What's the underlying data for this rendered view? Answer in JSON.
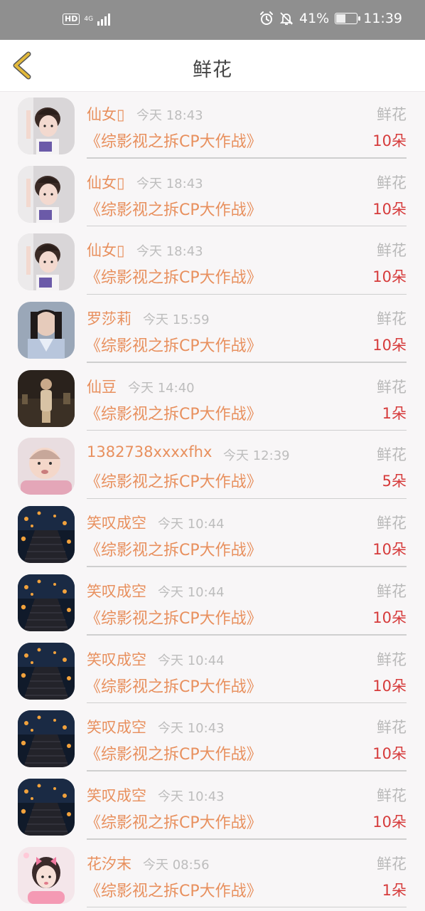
{
  "status_bar": {
    "network_badge": "HD",
    "network_type": "4G",
    "battery_level": 0.41,
    "battery_text": "41%",
    "time": "11:39"
  },
  "header": {
    "title": "鲜花",
    "back_icon": "chevron-left-icon"
  },
  "colors": {
    "accent": "#e8905e",
    "quantity": "#d63b3b",
    "back_arrow": "#e2b93b"
  },
  "records": [
    {
      "name": "仙女▯",
      "time": "今天 18:43",
      "gift": "鲜花",
      "book": "《综影视之拆CP大作战》",
      "quantity": "10朵",
      "avatar": "girl-avatar"
    },
    {
      "name": "仙女▯",
      "time": "今天 18:43",
      "gift": "鲜花",
      "book": "《综影视之拆CP大作战》",
      "quantity": "10朵",
      "avatar": "girl-avatar"
    },
    {
      "name": "仙女▯",
      "time": "今天 18:43",
      "gift": "鲜花",
      "book": "《综影视之拆CP大作战》",
      "quantity": "10朵",
      "avatar": "girl-avatar"
    },
    {
      "name": "罗莎莉",
      "time": "今天 15:59",
      "gift": "鲜花",
      "book": "《综影视之拆CP大作战》",
      "quantity": "10朵",
      "avatar": "man-avatar"
    },
    {
      "name": "仙豆",
      "time": "今天 14:40",
      "gift": "鲜花",
      "book": "《综影视之拆CP大作战》",
      "quantity": "1朵",
      "avatar": "figure-avatar"
    },
    {
      "name": "1382738xxxxfhx",
      "time": "今天 12:39",
      "gift": "鲜花",
      "book": "《综影视之拆CP大作战》",
      "quantity": "5朵",
      "avatar": "baby-avatar"
    },
    {
      "name": "笑叹成空",
      "time": "今天 10:44",
      "gift": "鲜花",
      "book": "《综影视之拆CP大作战》",
      "quantity": "10朵",
      "avatar": "lantern-avatar"
    },
    {
      "name": "笑叹成空",
      "time": "今天 10:44",
      "gift": "鲜花",
      "book": "《综影视之拆CP大作战》",
      "quantity": "10朵",
      "avatar": "lantern-avatar"
    },
    {
      "name": "笑叹成空",
      "time": "今天 10:44",
      "gift": "鲜花",
      "book": "《综影视之拆CP大作战》",
      "quantity": "10朵",
      "avatar": "lantern-avatar"
    },
    {
      "name": "笑叹成空",
      "time": "今天 10:43",
      "gift": "鲜花",
      "book": "《综影视之拆CP大作战》",
      "quantity": "10朵",
      "avatar": "lantern-avatar"
    },
    {
      "name": "笑叹成空",
      "time": "今天 10:43",
      "gift": "鲜花",
      "book": "《综影视之拆CP大作战》",
      "quantity": "10朵",
      "avatar": "lantern-avatar"
    },
    {
      "name": "花汐末",
      "time": "今天 08:56",
      "gift": "鲜花",
      "book": "《综影视之拆CP大作战》",
      "quantity": "1朵",
      "avatar": "pink-girl-avatar"
    }
  ]
}
